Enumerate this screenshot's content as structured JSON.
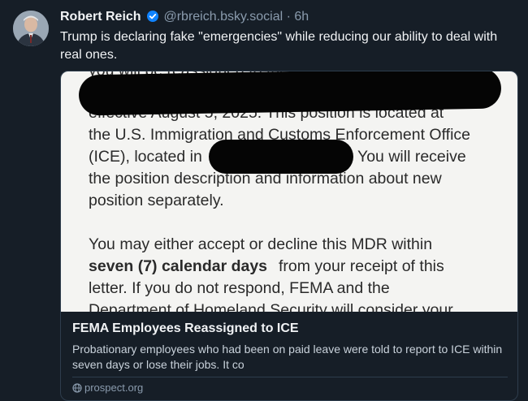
{
  "author": {
    "name": "Robert Reich",
    "handle": "@rbreich.bsky.social",
    "separator": "·",
    "time": "6h"
  },
  "post": {
    "text": "Trump is declaring fake \"emergencies\" while reducing our ability to deal with real ones."
  },
  "card": {
    "document_lines": [
      "you will be reassigned to the position of",
      "effective August 5, 2025.  This position is located at",
      "the U.S. Immigration and Customs Enforcement Office",
      "(ICE), located in",
      "You will receive",
      "the position description and information about new",
      "position separately.",
      "You may either accept or decline this MDR within",
      "seven (7) calendar days",
      "from your receipt of this",
      "letter. If you do not respond, FEMA and the",
      "Department of Homeland Security will consider your"
    ],
    "title": "FEMA Employees Reassigned to ICE",
    "description": "Probationary employees who had been on paid leave were told to report to ICE within seven days or lose their jobs. It co",
    "source": "prospect.org"
  },
  "colors": {
    "background": "#161e27",
    "handle": "#8a9bad",
    "verified": "#1083fe",
    "border": "#2e3d4d"
  }
}
